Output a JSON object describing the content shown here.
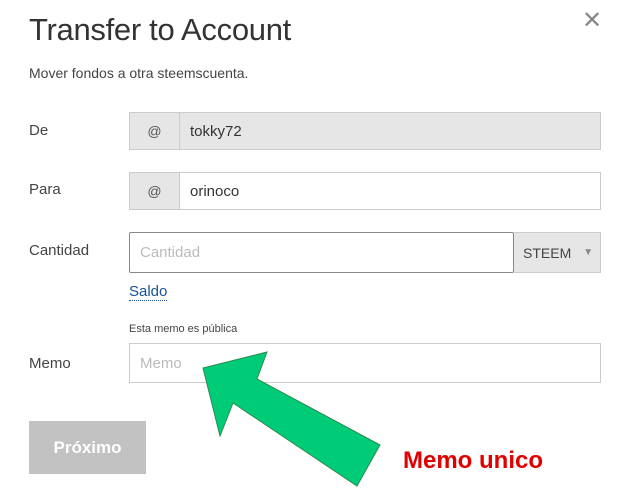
{
  "dialog": {
    "title": "Transfer to Account",
    "subtitle": "Mover fondos a otra steemscuenta.",
    "close_icon": "close-icon"
  },
  "form": {
    "from": {
      "label": "De",
      "prefix": "@",
      "value": "tokky72"
    },
    "to": {
      "label": "Para",
      "prefix": "@",
      "value": "orinoco"
    },
    "amount": {
      "label": "Cantidad",
      "placeholder": "Cantidad",
      "currency": "STEEM",
      "balance_link": "Saldo"
    },
    "memo": {
      "label": "Memo",
      "hint": "Esta memo es pública",
      "placeholder": "Memo"
    },
    "submit": "Próximo"
  },
  "annotation": {
    "text": "Memo unico",
    "arrow_color": "#00cc77",
    "text_color": "#e00000"
  }
}
